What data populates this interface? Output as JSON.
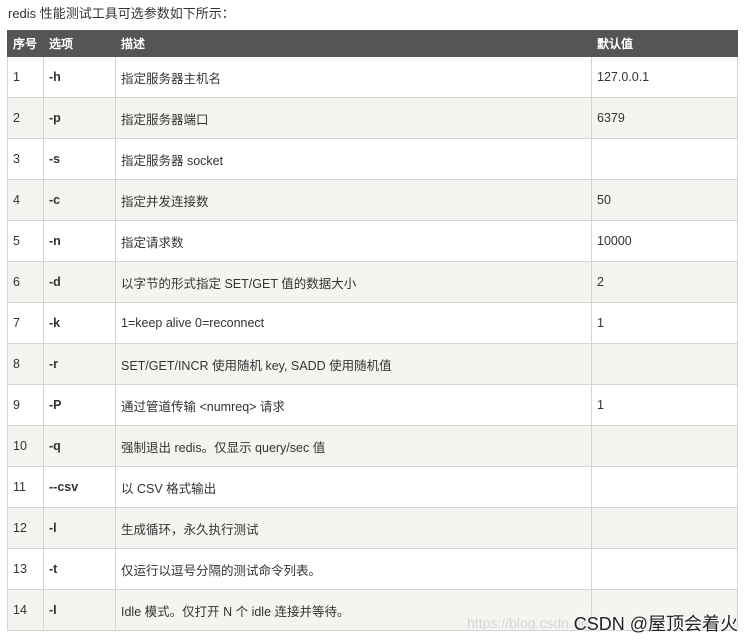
{
  "intro": "redis 性能测试工具可选参数如下所示：",
  "table": {
    "headers": {
      "index": "序号",
      "option": "选项",
      "description": "描述",
      "default": "默认值"
    },
    "rows": [
      {
        "index": "1",
        "option": "-h",
        "description": "指定服务器主机名",
        "default": "127.0.0.1"
      },
      {
        "index": "2",
        "option": "-p",
        "description": "指定服务器端口",
        "default": "6379"
      },
      {
        "index": "3",
        "option": "-s",
        "description": "指定服务器 socket",
        "default": ""
      },
      {
        "index": "4",
        "option": "-c",
        "description": "指定并发连接数",
        "default": "50"
      },
      {
        "index": "5",
        "option": "-n",
        "description": "指定请求数",
        "default": "10000"
      },
      {
        "index": "6",
        "option": "-d",
        "description": "以字节的形式指定 SET/GET 值的数据大小",
        "default": "2"
      },
      {
        "index": "7",
        "option": "-k",
        "description": "1=keep alive 0=reconnect",
        "default": "1"
      },
      {
        "index": "8",
        "option": "-r",
        "description": "SET/GET/INCR 使用随机 key, SADD 使用随机值",
        "default": ""
      },
      {
        "index": "9",
        "option": "-P",
        "description": "通过管道传输 <numreq> 请求",
        "default": "1"
      },
      {
        "index": "10",
        "option": "-q",
        "description": "强制退出 redis。仅显示 query/sec 值",
        "default": ""
      },
      {
        "index": "11",
        "option": "--csv",
        "description": "以 CSV 格式输出",
        "default": ""
      },
      {
        "index": "12",
        "option": "-l",
        "description": "生成循环，永久执行测试",
        "default": ""
      },
      {
        "index": "13",
        "option": "-t",
        "description": "仅运行以逗号分隔的测试命令列表。",
        "default": ""
      },
      {
        "index": "14",
        "option": "-I",
        "description": "Idle 模式。仅打开 N 个 idle 连接并等待。",
        "default": ""
      }
    ]
  },
  "watermark": "CSDN @屋顶会着火",
  "watermark_url": "https://blog.csdn.net"
}
